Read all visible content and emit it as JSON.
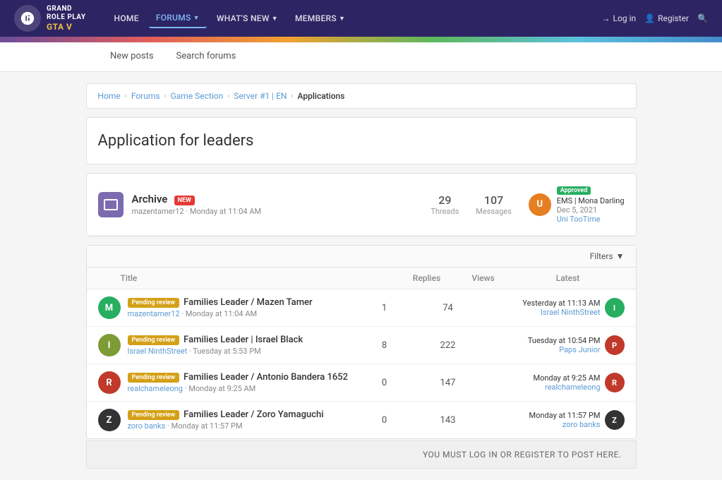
{
  "header": {
    "logo_line1": "GRAND",
    "logo_line2": "ROLE PLAY",
    "logo_gta": "GTA V",
    "nav": [
      {
        "label": "HOME",
        "active": false
      },
      {
        "label": "FORUMS",
        "active": true,
        "caret": true
      },
      {
        "label": "WHAT'S NEW",
        "active": false,
        "caret": true
      },
      {
        "label": "MEMBERS",
        "active": false,
        "caret": true
      }
    ],
    "login_label": "Log in",
    "register_label": "Register"
  },
  "toolbar": {
    "new_posts_label": "New posts",
    "search_forums_label": "Search forums"
  },
  "breadcrumb": {
    "items": [
      "Home",
      "Forums",
      "Game Section",
      "Server #1 | EN",
      "Applications"
    ]
  },
  "page_title": "Application for leaders",
  "archive": {
    "name": "Archive",
    "new_badge": "NEW",
    "meta": "mazentamer12 · Monday at 11:04 AM",
    "threads_count": "29",
    "threads_label": "Threads",
    "messages_count": "107",
    "messages_label": "Messages",
    "approved_label": "Approved",
    "latest_title": "EMS | Mona Darling",
    "latest_date": "Dec 5, 2021",
    "latest_user": "Uni TooTime"
  },
  "filters_label": "Filters",
  "columns": {
    "title": "Title",
    "replies": "Replies",
    "views": "Views",
    "latest": "Latest"
  },
  "threads": [
    {
      "id": 1,
      "avatar_letter": "M",
      "avatar_color": "green",
      "status_tag": "Pending review",
      "title": "Families Leader / Mazen Tamer",
      "author": "mazentamer12",
      "date": "Monday at 11:04 AM",
      "replies": "1",
      "views": "74",
      "latest_time": "Yesterday at 11:13 AM",
      "latest_user": "Israel NinthStreet",
      "latest_avatar": "I",
      "latest_avatar_color": "#27ae60"
    },
    {
      "id": 2,
      "avatar_letter": "I",
      "avatar_color": "olive",
      "status_tag": "Pending review",
      "title": "Families Leader | Israel Black",
      "author": "Israel NinthStreet",
      "date": "Tuesday at 5:53 PM",
      "replies": "8",
      "views": "222",
      "latest_time": "Tuesday at 10:54 PM",
      "latest_user": "Paps Junior",
      "latest_avatar": "P",
      "latest_avatar_color": "#c0392b"
    },
    {
      "id": 3,
      "avatar_letter": "R",
      "avatar_color": "red",
      "status_tag": "Pending review",
      "title": "Families Leader / Antonio Bandera 1652",
      "author": "realchameleong",
      "date": "Monday at 9:25 AM",
      "replies": "0",
      "views": "147",
      "latest_time": "Monday at 9:25 AM",
      "latest_user": "realchameleong",
      "latest_avatar": "R",
      "latest_avatar_color": "#c0392b"
    },
    {
      "id": 4,
      "avatar_letter": "Z",
      "avatar_color": "dark",
      "status_tag": "Pending review",
      "title": "Families Leader / Zoro Yamaguchi",
      "author": "zoro banks",
      "date": "Monday at 11:57 PM",
      "replies": "0",
      "views": "143",
      "latest_time": "Monday at 11:57 PM",
      "latest_user": "zoro banks",
      "latest_avatar": "Z",
      "latest_avatar_color": "#333"
    }
  ],
  "login_prompt": "YOU MUST LOG IN OR REGISTER TO POST HERE."
}
